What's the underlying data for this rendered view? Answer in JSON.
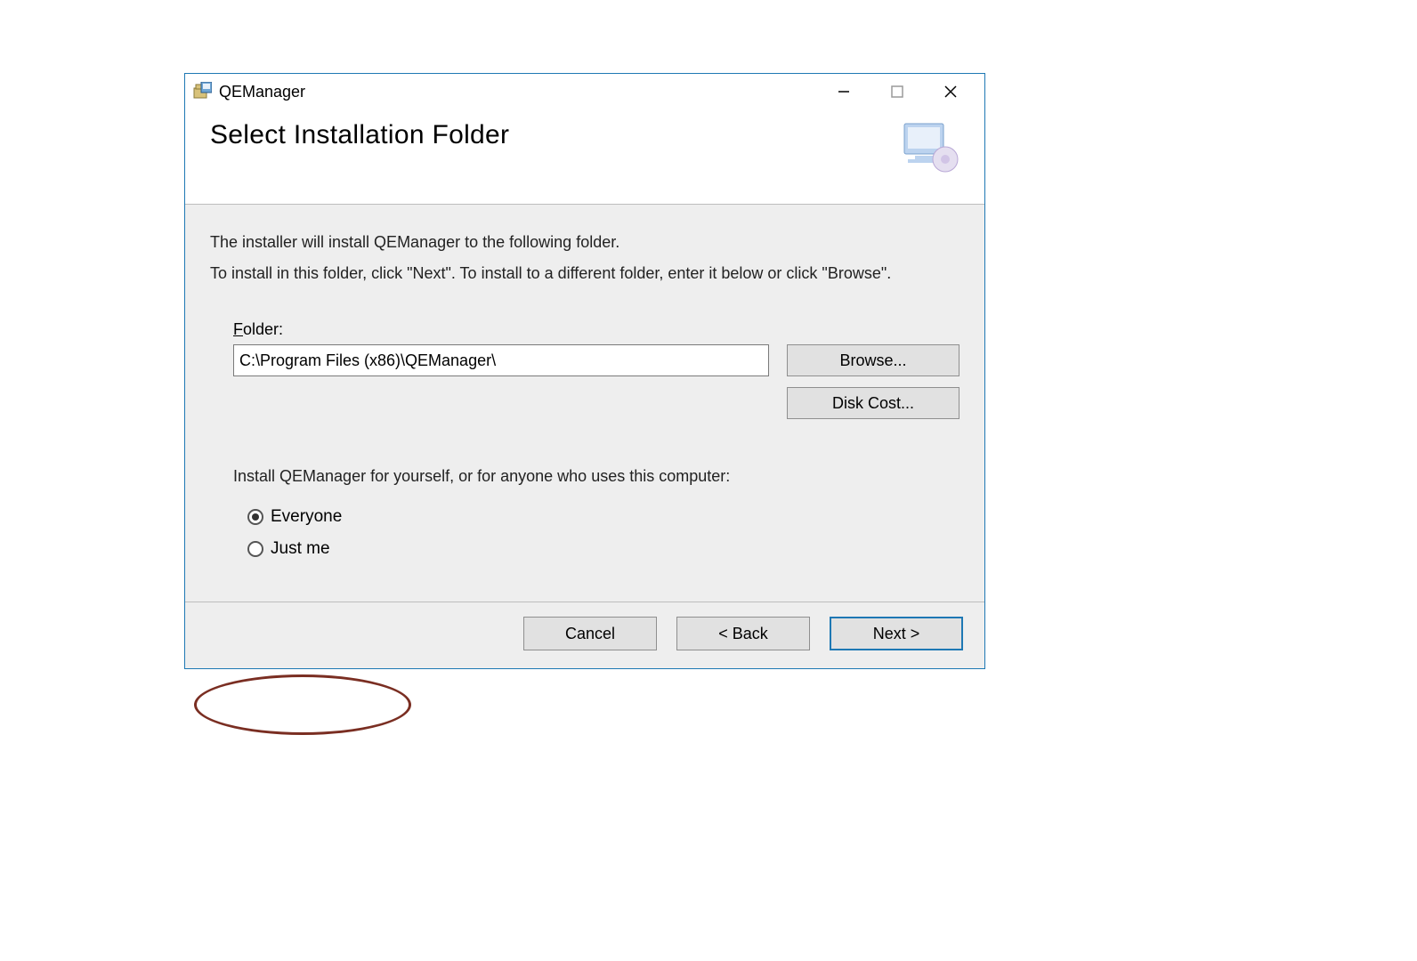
{
  "window": {
    "title": "QEManager"
  },
  "header": {
    "title": "Select Installation Folder"
  },
  "body": {
    "line1": "The installer will install QEManager to the following folder.",
    "line2": "To install in this folder, click \"Next\". To install to a different folder, enter it below or click \"Browse\".",
    "folder_label_prefix": "F",
    "folder_label_rest": "older:",
    "folder_value": "C:\\Program Files (x86)\\QEManager\\",
    "browse_label": "Browse...",
    "diskcost_label": "Disk Cost...",
    "scope_question": "Install QEManager for yourself, or for anyone who uses this computer:",
    "radio_everyone": "Everyone",
    "radio_justme": "Just me",
    "selected_scope": "everyone"
  },
  "footer": {
    "cancel": "Cancel",
    "back": "< Back",
    "next": "Next >"
  }
}
